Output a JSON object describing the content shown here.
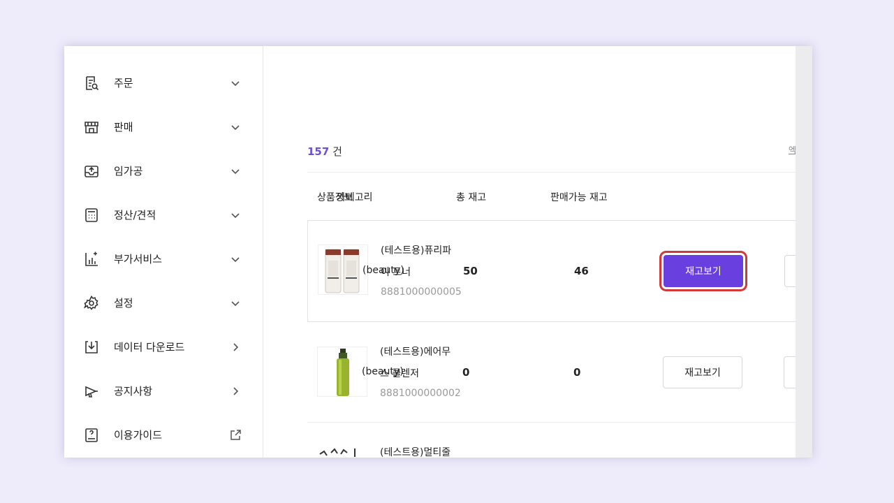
{
  "sidebar": {
    "items": [
      {
        "label": "주문",
        "icon": "order-search-icon",
        "arrow": "chevron-down-icon"
      },
      {
        "label": "판매",
        "icon": "store-icon",
        "arrow": "chevron-down-icon"
      },
      {
        "label": "임가공",
        "icon": "inbox-icon",
        "arrow": "chevron-down-icon"
      },
      {
        "label": "정산/견적",
        "icon": "calculator-icon",
        "arrow": "chevron-down-icon"
      },
      {
        "label": "부가서비스",
        "icon": "chart-plus-icon",
        "arrow": "chevron-down-icon"
      },
      {
        "label": "설정",
        "icon": "gear-icon",
        "arrow": "chevron-down-icon"
      },
      {
        "label": "데이터 다운로드",
        "icon": "download-icon",
        "arrow": "chevron-right-icon"
      },
      {
        "label": "공지사항",
        "icon": "megaphone-icon",
        "arrow": "chevron-right-icon"
      },
      {
        "label": "이용가이드",
        "icon": "guide-book-icon",
        "arrow": "external-link-icon"
      }
    ]
  },
  "list": {
    "count": "157",
    "count_unit": "건",
    "excel_label": "엑"
  },
  "table": {
    "headers": {
      "product_info": "상품정보",
      "category": "카테고리",
      "total_stock": "총 재고",
      "available_stock": "판매가능 재고"
    },
    "rows": [
      {
        "name_line1": "(테스트용)퓨리파",
        "name_line2": "이 토너",
        "category": "(beauty)",
        "code": "8881000000005",
        "total": "50",
        "available": "46",
        "button": "재고보기"
      },
      {
        "name_line1": "(테스트용)에어무",
        "name_line2": "스 클렌저",
        "category": "(beauty)",
        "code": "8881000000002",
        "total": "0",
        "available": "0",
        "button": "재고보기"
      },
      {
        "name_line1": "(테스트용)멀티줄",
        "name_line2": "",
        "category": "",
        "code": "",
        "total": "",
        "available": "",
        "button": ""
      }
    ]
  },
  "colors": {
    "accent": "#6a3fe0",
    "count_color": "#6e4fd8",
    "highlight_ring": "#d23a3a",
    "background": "#eeecfb"
  }
}
